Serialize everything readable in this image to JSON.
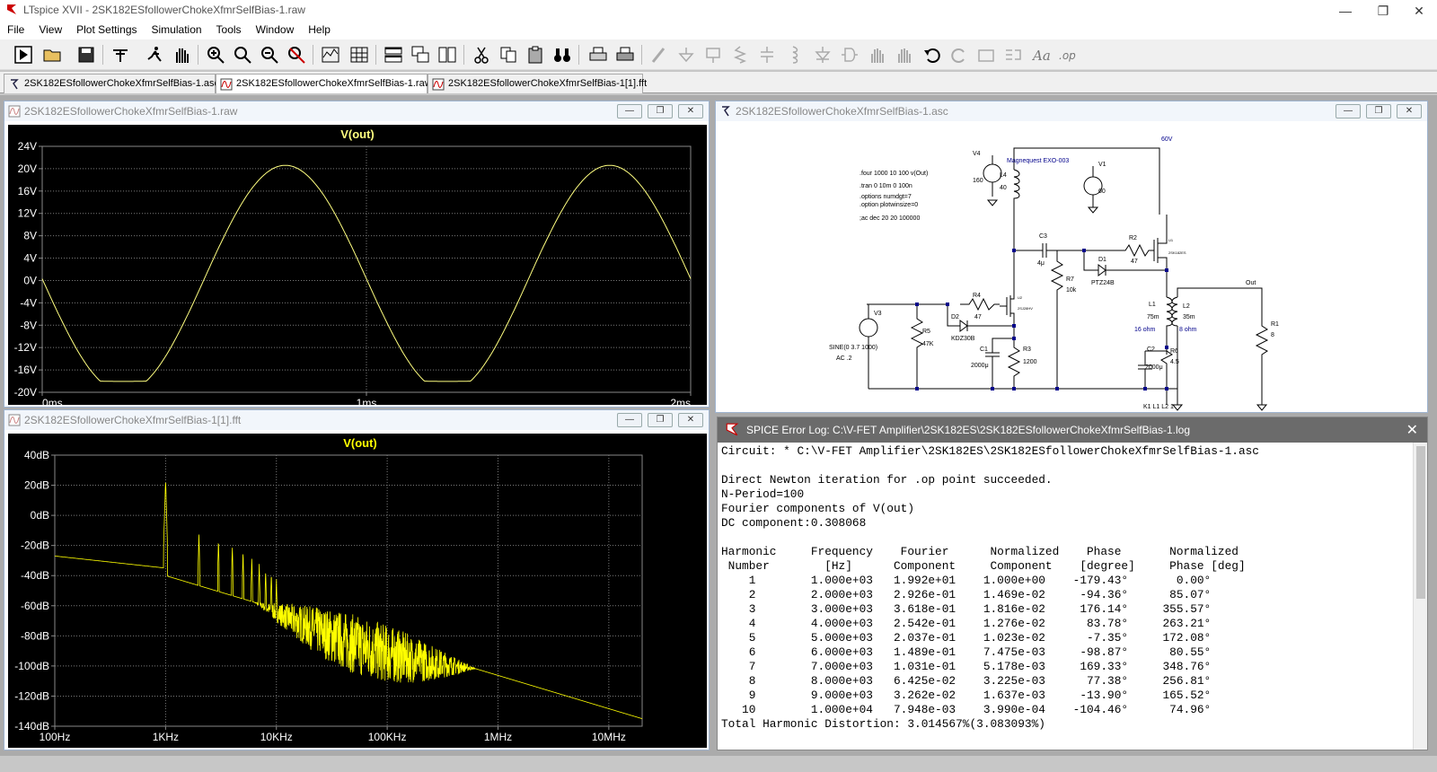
{
  "window": {
    "title": "LTspice XVII - 2SK182ESfollowerChokeXfmrSelfBias-1.raw",
    "controls": [
      "—",
      "❐",
      "✕"
    ]
  },
  "menu": [
    "File",
    "View",
    "Plot Settings",
    "Simulation",
    "Tools",
    "Window",
    "Help"
  ],
  "tabs": [
    {
      "label": "2SK182ESfollowerChokeXfmrSelfBias-1.asc",
      "icon": "schematic-icon"
    },
    {
      "label": "2SK182ESfollowerChokeXfmrSelfBias-1.raw",
      "icon": "waveform-icon"
    },
    {
      "label": "2SK182ESfollowerChokeXfmrSelfBias-1[1].fft",
      "icon": "fft-icon"
    }
  ],
  "waveform_window": {
    "title": "2SK182ESfollowerChokeXfmrSelfBias-1.raw",
    "btn_min": "—",
    "btn_max": "❐",
    "btn_close": "✕"
  },
  "fft_window": {
    "title": "2SK182ESfollowerChokeXfmrSelfBias-1[1].fft",
    "btn_min": "—",
    "btn_max": "❐",
    "btn_close": "✕"
  },
  "schematic_window": {
    "title": "2SK182ESfollowerChokeXfmrSelfBias-1.asc",
    "btn_min": "—",
    "btn_max": "❐",
    "btn_close": "✕",
    "directives": [
      ".four 1000 10 100 v(Out)",
      ".tran 0 10m 0 100n",
      ".options numdgt=7",
      ".option plotwinsize=0",
      ";ac dec 20 20 100000"
    ],
    "labels": {
      "v4": "V4",
      "v4val": "160",
      "l4": "L4",
      "l4val": "40",
      "magnequest": "Magnequest EXO-003",
      "v1": "V1",
      "v1val": "60",
      "net60v": "60V",
      "c3": "C3",
      "c3val": "4μ",
      "r2": "R2",
      "r2val": "47",
      "d1": "D1",
      "d1val": "PTZ24B",
      "r7": "R7",
      "r7val": "10k",
      "r4": "R4",
      "r4val": "47",
      "d2": "D2",
      "d2val": "KDZ30B",
      "v3": "V3",
      "v3src": "SINE(0 3.7 1000)",
      "v3ac": "AC .2",
      "r5": "R5",
      "r5val": "47K",
      "c1": "C1",
      "c1val": "2000μ",
      "r3": "R3",
      "r3val": "1200",
      "l1": "L1",
      "l1val": "75m",
      "l1ohm": "16 ohm",
      "l2": "L2",
      "l2val": "35m",
      "l2ohm": "8 ohm",
      "c2": "C2",
      "c2val": "2000μ",
      "r6": "R6",
      "r6val": "4.5",
      "out": "Out",
      "r1": "R1",
      "r1val": "8",
      "kdir": "K1 L1 L2 1",
      "u1": "U1",
      "u1part": "2SK182ES",
      "u2": "U2",
      "u2part": "2SJ28HV"
    }
  },
  "error_log": {
    "title": "SPICE Error Log: C:\\V-FET Amplifier\\2SK182ES\\2SK182ESfollowerChokeXfmrSelfBias-1.log",
    "close": "✕",
    "text": "Circuit: * C:\\V-FET Amplifier\\2SK182ES\\2SK182ESfollowerChokeXfmrSelfBias-1.asc\n\nDirect Newton iteration for .op point succeeded.\nN-Period=100\nFourier components of V(out)\nDC component:0.308068\n\nHarmonic     Frequency    Fourier      Normalized    Phase       Normalized\n Number        [Hz]      Component     Component    [degree]     Phase [deg]\n    1        1.000e+03   1.992e+01    1.000e+00    -179.43°       0.00°\n    2        2.000e+03   2.926e-01    1.469e-02     -94.36°      85.07°\n    3        3.000e+03   3.618e-01    1.816e-02     176.14°     355.57°\n    4        4.000e+03   2.542e-01    1.276e-02      83.78°     263.21°\n    5        5.000e+03   2.037e-01    1.023e-02      -7.35°     172.08°\n    6        6.000e+03   1.489e-01    7.475e-03     -98.87°      80.55°\n    7        7.000e+03   1.031e-01    5.178e-03     169.33°     348.76°\n    8        8.000e+03   6.425e-02    3.225e-03      77.38°     256.81°\n    9        9.000e+03   3.262e-02    1.637e-03     -13.90°     165.52°\n   10        1.000e+04   7.948e-03    3.990e-04    -104.46°      74.96°\nTotal Harmonic Distortion: 3.014567%(3.083093%)"
  },
  "chart_data": [
    {
      "type": "line",
      "title": "V(out)",
      "xlabel": "",
      "ylabel": "",
      "x_unit": "ms",
      "xlim": [
        0,
        2
      ],
      "ylim": [
        -20,
        24
      ],
      "y_ticks": [
        "24V",
        "20V",
        "16V",
        "12V",
        "8V",
        "4V",
        "0V",
        "-4V",
        "-8V",
        "-12V",
        "-16V",
        "-20V"
      ],
      "x_ticks": [
        "0ms",
        "1ms",
        "2ms"
      ],
      "series": [
        {
          "color": "#ffff80",
          "amplitude": 20.3,
          "frequency_hz": 1000,
          "dc_offset": 0.3,
          "clip_low": -18.0,
          "phase": "inverted"
        }
      ],
      "grid": true
    },
    {
      "type": "line",
      "title": "V(out)",
      "xlabel": "",
      "ylabel": "",
      "x_scale": "log",
      "xlim": [
        100,
        20000000
      ],
      "ylim": [
        -140,
        40
      ],
      "y_ticks": [
        "40dB",
        "20dB",
        "0dB",
        "-20dB",
        "-40dB",
        "-60dB",
        "-80dB",
        "-100dB",
        "-120dB",
        "-140dB"
      ],
      "x_ticks": [
        "100Hz",
        "1KHz",
        "10KHz",
        "100KHz",
        "1MHz",
        "10MHz"
      ],
      "series": [
        {
          "color": "#ffff00",
          "fundamental_hz": 1000,
          "fundamental_db": 24,
          "harmonic_peaks_db": [
            [
              2000,
              -12
            ],
            [
              3000,
              -16
            ],
            [
              4000,
              -20
            ],
            [
              5000,
              -24
            ],
            [
              6000,
              -28
            ],
            [
              7000,
              -32
            ],
            [
              8000,
              -36
            ],
            [
              9000,
              -38
            ],
            [
              10000,
              -42
            ]
          ],
          "floor_start_db": -27,
          "floor_end_db": -135
        }
      ],
      "grid": true
    }
  ]
}
